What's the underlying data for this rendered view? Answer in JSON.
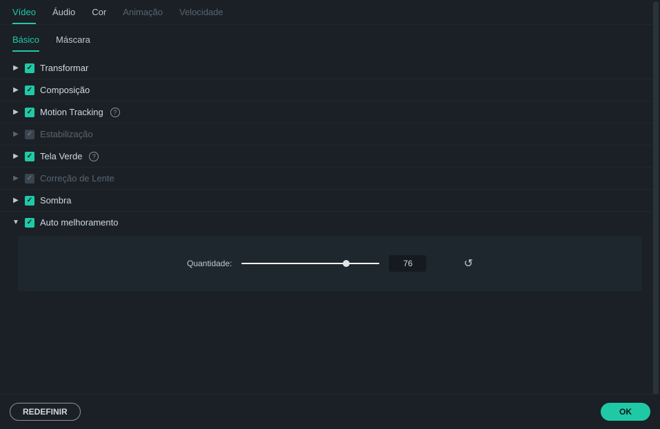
{
  "mainTabs": {
    "video": "Vídeo",
    "audio": "Áudio",
    "color": "Cor",
    "animation": "Animação",
    "speed": "Velocidade"
  },
  "subTabs": {
    "basic": "Básico",
    "mask": "Máscara"
  },
  "sections": {
    "transform": "Transformar",
    "composition": "Composição",
    "motionTracking": "Motion Tracking",
    "stabilization": "Estabilização",
    "greenScreen": "Tela Verde",
    "lensCorrection": "Correção de Lente",
    "shadow": "Sombra",
    "autoEnhance": "Auto melhoramento"
  },
  "panel": {
    "quantityLabel": "Quantidade:",
    "quantityValue": "76",
    "sliderPercent": 76
  },
  "footer": {
    "reset": "REDEFINIR",
    "ok": "OK"
  }
}
